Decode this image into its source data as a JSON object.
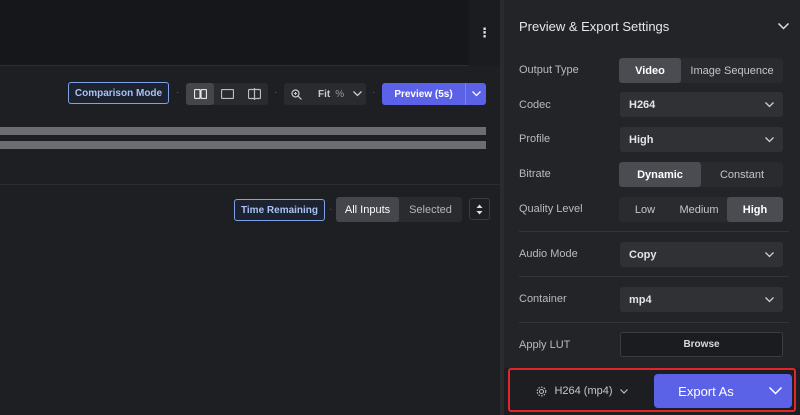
{
  "toolbar": {
    "comparison_mode": "Comparison Mode",
    "zoom_label": "Fit",
    "zoom_unit": "%",
    "preview_label": "Preview (5s)"
  },
  "queue": {
    "time_remaining": "Time Remaining",
    "filters": [
      "All Inputs",
      "Selected"
    ],
    "active_filter": "All Inputs"
  },
  "panel": {
    "title": "Preview & Export Settings",
    "output_type": {
      "label": "Output Type",
      "options": [
        "Video",
        "Image Sequence"
      ],
      "selected": "Video"
    },
    "codec": {
      "label": "Codec",
      "value": "H264"
    },
    "profile": {
      "label": "Profile",
      "value": "High"
    },
    "bitrate": {
      "label": "Bitrate",
      "options": [
        "Dynamic",
        "Constant"
      ],
      "selected": "Dynamic"
    },
    "quality": {
      "label": "Quality Level",
      "options": [
        "Low",
        "Medium",
        "High"
      ],
      "selected": "High"
    },
    "audio_mode": {
      "label": "Audio Mode",
      "value": "Copy"
    },
    "container": {
      "label": "Container",
      "value": "mp4"
    },
    "lut": {
      "label": "Apply LUT",
      "button": "Browse"
    }
  },
  "footer": {
    "preset": "H264 (mp4)",
    "export_label": "Export As"
  },
  "colors": {
    "accent": "#5b62e8",
    "highlight": "#e0262b",
    "outline_blue": "#7fa1e8"
  }
}
